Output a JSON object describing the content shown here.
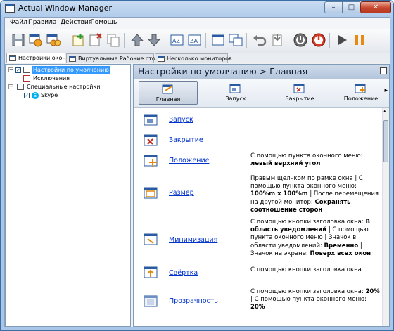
{
  "window": {
    "title": "Actual Window Manager",
    "controls": {
      "minimize": "–",
      "maximize": "□",
      "close": "✕"
    }
  },
  "menu": {
    "items": [
      "Файл",
      "Правила",
      "Действия",
      "Помощь"
    ]
  },
  "toolbar": {
    "buttons": [
      "save-icon",
      "add-rule-icon",
      "copy-rule-icon",
      "new-icon",
      "delete-icon",
      "duplicate-icon",
      "move-up-icon",
      "move-down-icon",
      "sort-az-icon",
      "sort-za-icon",
      "window-icon",
      "windows-icon",
      "undo-icon",
      "import-icon",
      "power-icon",
      "stop-icon",
      "play-icon",
      "pause-icon"
    ]
  },
  "tabs": [
    {
      "label": "Настройки окон"
    },
    {
      "label": "Виртуальные Рабочие столы"
    },
    {
      "label": "Несколько мониторов"
    }
  ],
  "tree": {
    "items": [
      {
        "label": "Настройки по умолчанию"
      },
      {
        "label": "Исключения"
      },
      {
        "label": "Специальные настройки"
      },
      {
        "label": "Skype"
      }
    ]
  },
  "panel": {
    "header": "Настройки по умолчанию > Главная",
    "subtabs": [
      {
        "label": "Главная"
      },
      {
        "label": "Запуск"
      },
      {
        "label": "Закрытие"
      },
      {
        "label": "Положение"
      }
    ]
  },
  "settings": [
    {
      "link": "Запуск",
      "desc": []
    },
    {
      "link": "Закрытие",
      "desc": []
    },
    {
      "link": "Положение",
      "desc": [
        [
          "n",
          "С помощью пункта оконного меню: "
        ],
        [
          "b",
          "левый верхний угол"
        ]
      ]
    },
    {
      "link": "Размер",
      "desc": [
        [
          "n",
          "Правым щелчком по рамке окна | С помощью пункта оконного меню: "
        ],
        [
          "b",
          "100%m x 100%m"
        ],
        [
          "n",
          " | После перемещения на другой монитор: "
        ],
        [
          "b",
          "Сохранять соотношение сторон"
        ]
      ]
    },
    {
      "link": "Минимизация",
      "desc": [
        [
          "n",
          "С помощью кнопки заголовка окна: "
        ],
        [
          "b",
          "В область уведомлений"
        ],
        [
          "n",
          " | С помощью пункта оконного меню | Значок в области уведомлений: "
        ],
        [
          "b",
          "Временно"
        ],
        [
          "n",
          " | Значок на экране: "
        ],
        [
          "b",
          "Поверх всех окон"
        ]
      ]
    },
    {
      "link": "Свёртка",
      "desc": [
        [
          "n",
          "С помощью кнопки заголовка окна"
        ]
      ]
    },
    {
      "link": "Прозрачность",
      "desc": [
        [
          "n",
          "С помощью кнопки заголовка окна: "
        ],
        [
          "b",
          "20%"
        ],
        [
          "n",
          " | С помощью пункта оконного меню: "
        ],
        [
          "b",
          "20%"
        ]
      ]
    }
  ],
  "colors": {
    "link": "#0033cc",
    "accent": "#2a5aa0"
  }
}
